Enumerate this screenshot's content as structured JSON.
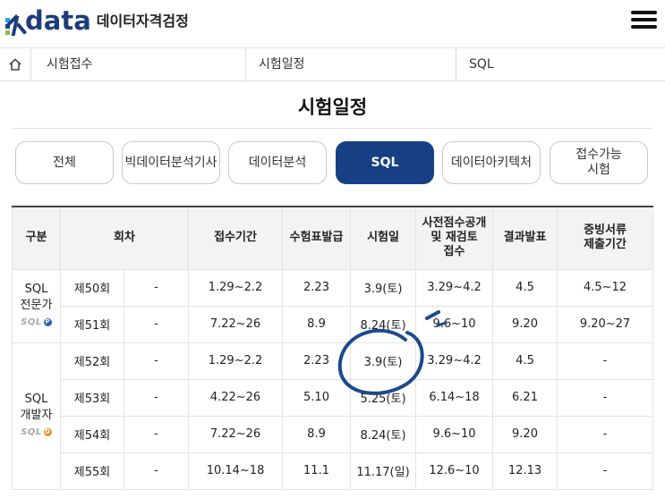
{
  "header": {
    "logo_word": "data",
    "logo_sub": "데이터자격검정"
  },
  "breadcrumb": {
    "items": [
      "시험접수",
      "시험일정",
      "SQL"
    ]
  },
  "page": {
    "title": "시험일정"
  },
  "tabs": [
    {
      "label": "전체",
      "active": false
    },
    {
      "label": "빅데이터분석기사",
      "active": false
    },
    {
      "label": "데이터분석",
      "active": false
    },
    {
      "label": "SQL",
      "active": true
    },
    {
      "label": "데이터아키텍처",
      "active": false
    },
    {
      "label": "접수가능\n시험",
      "active": false
    }
  ],
  "table": {
    "headers": {
      "category": "구분",
      "round": "회차",
      "reg_period": "접수기간",
      "admission": "수험표발급",
      "exam_date": "시험일",
      "prerelease": "사전점수공개\n및 재검토\n접수",
      "result": "결과발표",
      "docs": "증빙서류\n제출기간"
    },
    "groups": [
      {
        "label": "SQL\n전문가",
        "badge": "SQL",
        "badge_mark": "P",
        "badge_color": "#2b5fb3",
        "rows": [
          {
            "round": "제50회",
            "note": "-",
            "reg": "1.29~2.2",
            "admission": "2.23",
            "exam": "3.9(토)",
            "pre": "3.29~4.2",
            "result": "4.5",
            "docs": "4.5~12"
          },
          {
            "round": "제51회",
            "note": "-",
            "reg": "7.22~26",
            "admission": "8.9",
            "exam": "8.24(토)",
            "pre": "9.6~10",
            "result": "9.20",
            "docs": "9.20~27"
          }
        ]
      },
      {
        "label": "SQL\n개발자",
        "badge": "SQL",
        "badge_mark": "D",
        "badge_color": "#f08a24",
        "rows": [
          {
            "round": "제52회",
            "note": "-",
            "reg": "1.29~2.2",
            "admission": "2.23",
            "exam": "3.9(토)",
            "pre": "3.29~4.2",
            "result": "4.5",
            "docs": "-"
          },
          {
            "round": "제53회",
            "note": "-",
            "reg": "4.22~26",
            "admission": "5.10",
            "exam": "5.25(토)",
            "pre": "6.14~18",
            "result": "6.21",
            "docs": "-"
          },
          {
            "round": "제54회",
            "note": "-",
            "reg": "7.22~26",
            "admission": "8.9",
            "exam": "8.24(토)",
            "pre": "9.6~10",
            "result": "9.20",
            "docs": "-"
          },
          {
            "round": "제55회",
            "note": "-",
            "reg": "10.14~18",
            "admission": "11.1",
            "exam": "11.17(일)",
            "pre": "12.6~10",
            "result": "12.13",
            "docs": "-"
          }
        ]
      }
    ]
  },
  "colors": {
    "accent": "#173f83",
    "annotation": "#1c4a8c",
    "logo": "#1d3d7a"
  }
}
